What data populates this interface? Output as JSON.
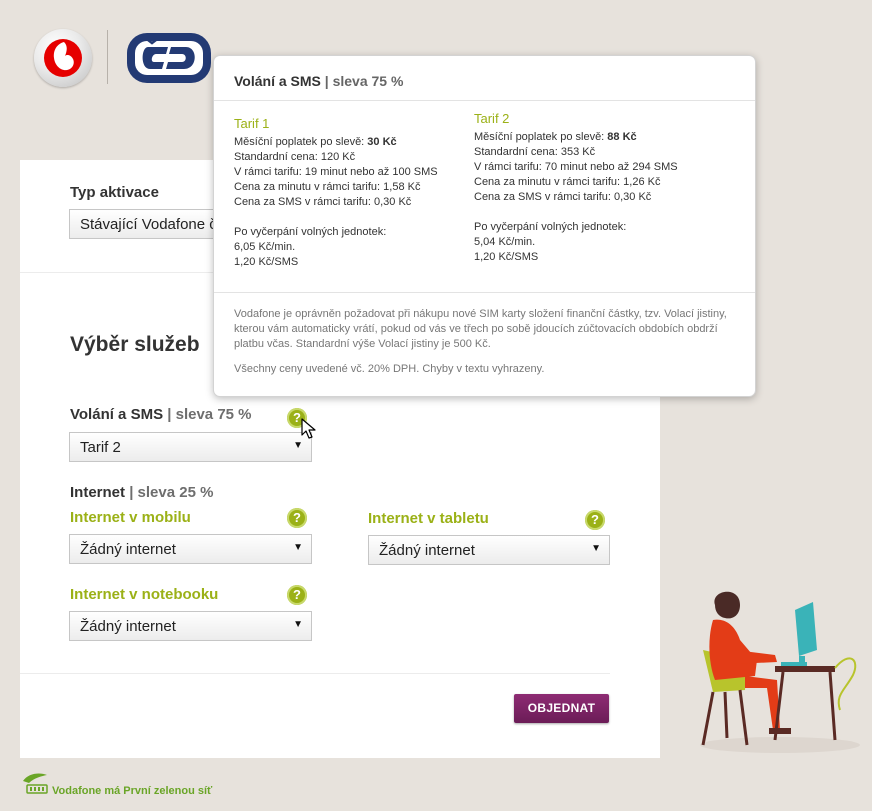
{
  "brand": {
    "footer_text": "Vodafone má První zelenou síť"
  },
  "activation": {
    "label": "Typ aktivace",
    "selected": "Stávající Vodafone č"
  },
  "services": {
    "heading": "Výběr služeb",
    "calls": {
      "label": "Volání a SMS",
      "discount": "| sleva 75 %",
      "selected": "Tarif 2"
    },
    "internet": {
      "label": "Internet",
      "discount": "| sleva 25 %"
    },
    "mobile": {
      "label": "Internet v mobilu",
      "selected": "Žádný internet"
    },
    "tablet": {
      "label": "Internet v tabletu",
      "selected": "Žádný internet"
    },
    "notebook": {
      "label": "Internet v notebooku",
      "selected": "Žádný internet"
    }
  },
  "order_button": "OBJEDNAT",
  "help_glyph": "?",
  "select_arrow": "▼",
  "tooltip": {
    "title": "Volání a SMS",
    "title_discount": "| sleva 75 %",
    "tarif1": {
      "name": "Tarif 1",
      "monthly_label": "Měsíční poplatek po slevě: ",
      "monthly_value": "30 Kč",
      "standard": "Standardní cena: 120 Kč",
      "included": "V rámci tarifu: 19 minut nebo až 100 SMS",
      "minute_price": "Cena za minutu v rámci tarifu: 1,58 Kč",
      "sms_price": "Cena za SMS v rámci tarifu: 0,30 Kč",
      "after_label": "Po vyčerpání volných jednotek:",
      "after_minute": "6,05 Kč/min.",
      "after_sms": "1,20 Kč/SMS"
    },
    "tarif2": {
      "name": "Tarif 2",
      "monthly_label": "Měsíční poplatek po slevě: ",
      "monthly_value": "88 Kč",
      "standard": "Standardní cena: 353 Kč",
      "included": "V rámci tarifu: 70 minut nebo až 294 SMS",
      "minute_price": "Cena za minutu v rámci tarifu: 1,26 Kč",
      "sms_price": "Cena za SMS v rámci tarifu: 0,30 Kč",
      "after_label": "Po vyčerpání volných jednotek:",
      "after_minute": "5,04 Kč/min.",
      "after_sms": "1,20 Kč/SMS"
    },
    "note1": "Vodafone je oprávněn požadovat při nákupu nové SIM karty složení finanční částky, tzv. Volací jistiny, kterou vám automaticky vrátí, pokud od vás ve třech po sobě jdoucích zúčtovacích obdobích obdrží platbu včas. Standardní výše Volací jistiny je 500 Kč.",
    "note2": "Všechny ceny uvedené vč. 20% DPH. Chyby v textu vyhrazeny."
  },
  "colors": {
    "accent_green": "#9bb117",
    "order_purple": "#7a2265",
    "vodafone_red": "#e60000",
    "cd_blue": "#233a74"
  }
}
